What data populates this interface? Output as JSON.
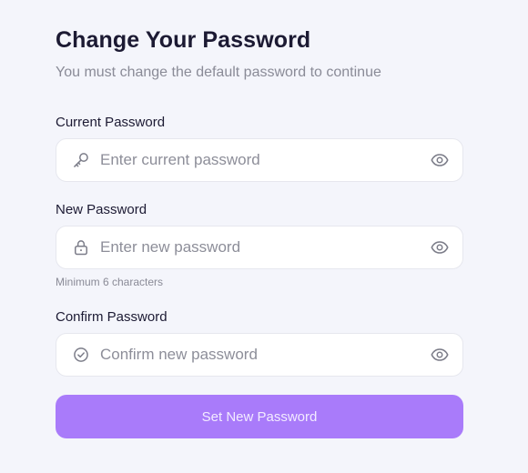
{
  "header": {
    "title": "Change Your Password",
    "subtitle": "You must change the default password to continue"
  },
  "fields": {
    "current": {
      "label": "Current Password",
      "placeholder": "Enter current password",
      "value": "",
      "icon": "key-icon"
    },
    "new": {
      "label": "New Password",
      "placeholder": "Enter new password",
      "value": "",
      "icon": "lock-icon",
      "hint": "Minimum 6 characters"
    },
    "confirm": {
      "label": "Confirm Password",
      "placeholder": "Confirm new password",
      "value": "",
      "icon": "check-circle-icon"
    }
  },
  "submit": {
    "label": "Set New Password"
  },
  "colors": {
    "background": "#f4f5fb",
    "accent": "#a97bfa",
    "text": "#1c1a33",
    "muted": "#8a8b97",
    "icon": "#7c7d89"
  }
}
